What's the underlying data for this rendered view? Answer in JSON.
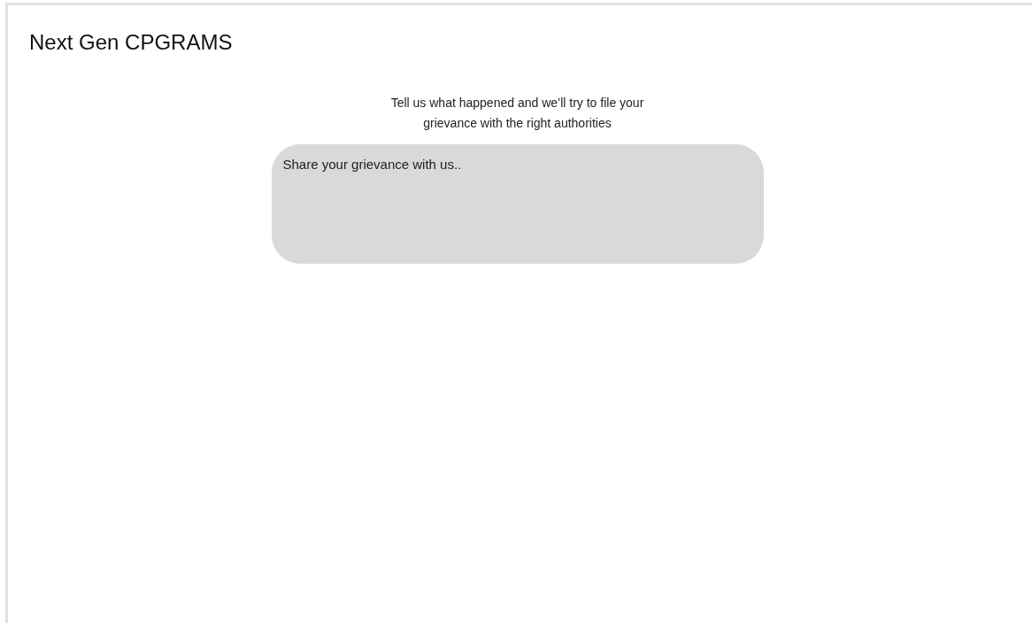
{
  "app_title": "Next Gen CPGRAMS",
  "intro": "Tell us what happened and we’ll try to file your grievance with the right authorities",
  "grievance_field": {
    "placeholder": "Share your grievance with us.."
  }
}
